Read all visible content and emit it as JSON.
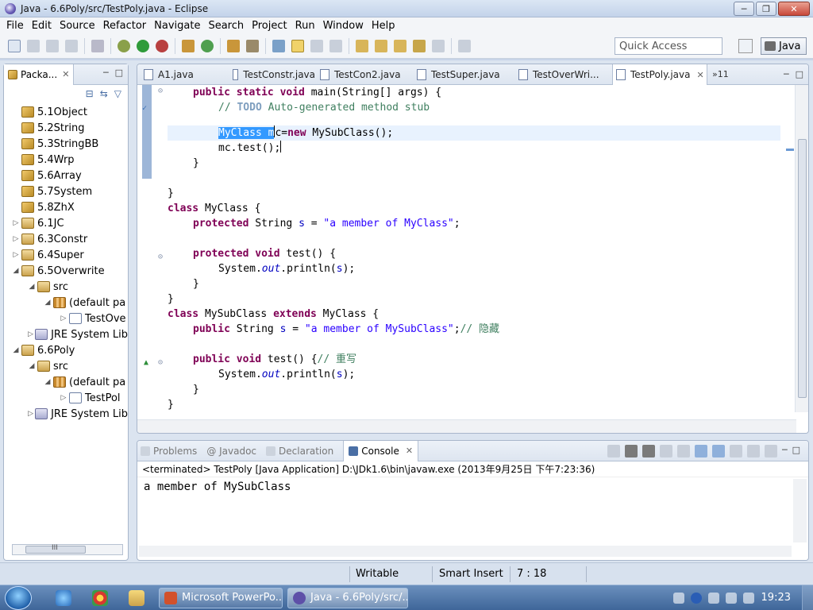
{
  "window": {
    "title": "Java - 6.6Poly/src/TestPoly.java - Eclipse"
  },
  "menu": [
    "File",
    "Edit",
    "Source",
    "Refactor",
    "Navigate",
    "Search",
    "Project",
    "Run",
    "Window",
    "Help"
  ],
  "toolbar": {
    "quick_access_placeholder": "Quick Access",
    "perspective": "Java"
  },
  "package_explorer": {
    "tab_label": "Packa...",
    "items": [
      {
        "label": "5.1Object"
      },
      {
        "label": "5.2String"
      },
      {
        "label": "5.3StringBB"
      },
      {
        "label": "5.4Wrp"
      },
      {
        "label": "5.6Array"
      },
      {
        "label": "5.7System"
      },
      {
        "label": "5.8ZhX"
      },
      {
        "label": "6.1JC"
      },
      {
        "label": "6.3Constr"
      },
      {
        "label": "6.4Super"
      },
      {
        "label": "6.5Overwrite"
      },
      {
        "label": "src"
      },
      {
        "label": "(default pa"
      },
      {
        "label": "TestOve"
      },
      {
        "label": "JRE System Lib"
      },
      {
        "label": "6.6Poly"
      },
      {
        "label": "src"
      },
      {
        "label": "(default pa"
      },
      {
        "label": "TestPol"
      },
      {
        "label": "JRE System Lib"
      }
    ],
    "scroll_glyph": "III"
  },
  "editor": {
    "tabs": [
      {
        "label": "A1.java"
      },
      {
        "label": "TestConstr.java"
      },
      {
        "label": "TestCon2.java"
      },
      {
        "label": "TestSuper.java"
      },
      {
        "label": "TestOverWri..."
      },
      {
        "label": "TestPoly.java"
      }
    ],
    "overflow_count": "»11",
    "code": {
      "l1_kw": "public static void",
      "l1_rest": " main(String[] args) {",
      "l2_prefix": "// ",
      "l2_todo": "TODO",
      "l2_rest": " Auto-generated method stub",
      "l3_sel": "MyClass m",
      "l3_c": "c",
      "l3_eq": "=",
      "l3_new": "new",
      "l3_rest": " MySubClass();",
      "l4": "mc.test();",
      "l5": "}",
      "l6": "}",
      "l7_kw": "class",
      "l7_rest": " MyClass {",
      "l8_kw": "protected",
      "l8_mid": " String ",
      "l8_field": "s",
      "l8_eq": " = ",
      "l8_str": "\"a member of MyClass\"",
      "l8_end": ";",
      "l9_kw": "protected void",
      "l9_rest": " test() {",
      "l10_a": "System.",
      "l10_out": "out",
      "l10_b": ".println(",
      "l10_s": "s",
      "l10_c": ");",
      "l11": "}",
      "l12": "}",
      "l13_kw": "class",
      "l13_mid": " MySubClass ",
      "l13_kw2": "extends",
      "l13_rest": " MyClass {",
      "l14_kw": "public",
      "l14_mid": " String ",
      "l14_field": "s",
      "l14_eq": " = ",
      "l14_str": "\"a member of MySubClass\"",
      "l14_end": ";",
      "l14_cm": "// 隐藏",
      "l15_kw": "public void",
      "l15_rest": " test() {",
      "l15_cm": "// 重写",
      "l16_a": "System.",
      "l16_out": "out",
      "l16_b": ".println(",
      "l16_s": "s",
      "l16_c": ");",
      "l17": "}",
      "l18": "}"
    }
  },
  "console": {
    "tabs": [
      {
        "label": "Problems"
      },
      {
        "label": "@ Javadoc"
      },
      {
        "label": "Declaration"
      },
      {
        "label": "Console"
      }
    ],
    "header": "<terminated> TestPoly [Java Application] D:\\JDk1.6\\bin\\javaw.exe (2013年9月25日 下午7:23:36)",
    "output": "a member of MySubClass"
  },
  "status": {
    "writable": "Writable",
    "insert_mode": "Smart Insert",
    "position": "7 : 18"
  },
  "taskbar": {
    "items": [
      {
        "label": "Microsoft PowerPo..."
      },
      {
        "label": "Java - 6.6Poly/src/..."
      }
    ],
    "clock": "19:23"
  }
}
